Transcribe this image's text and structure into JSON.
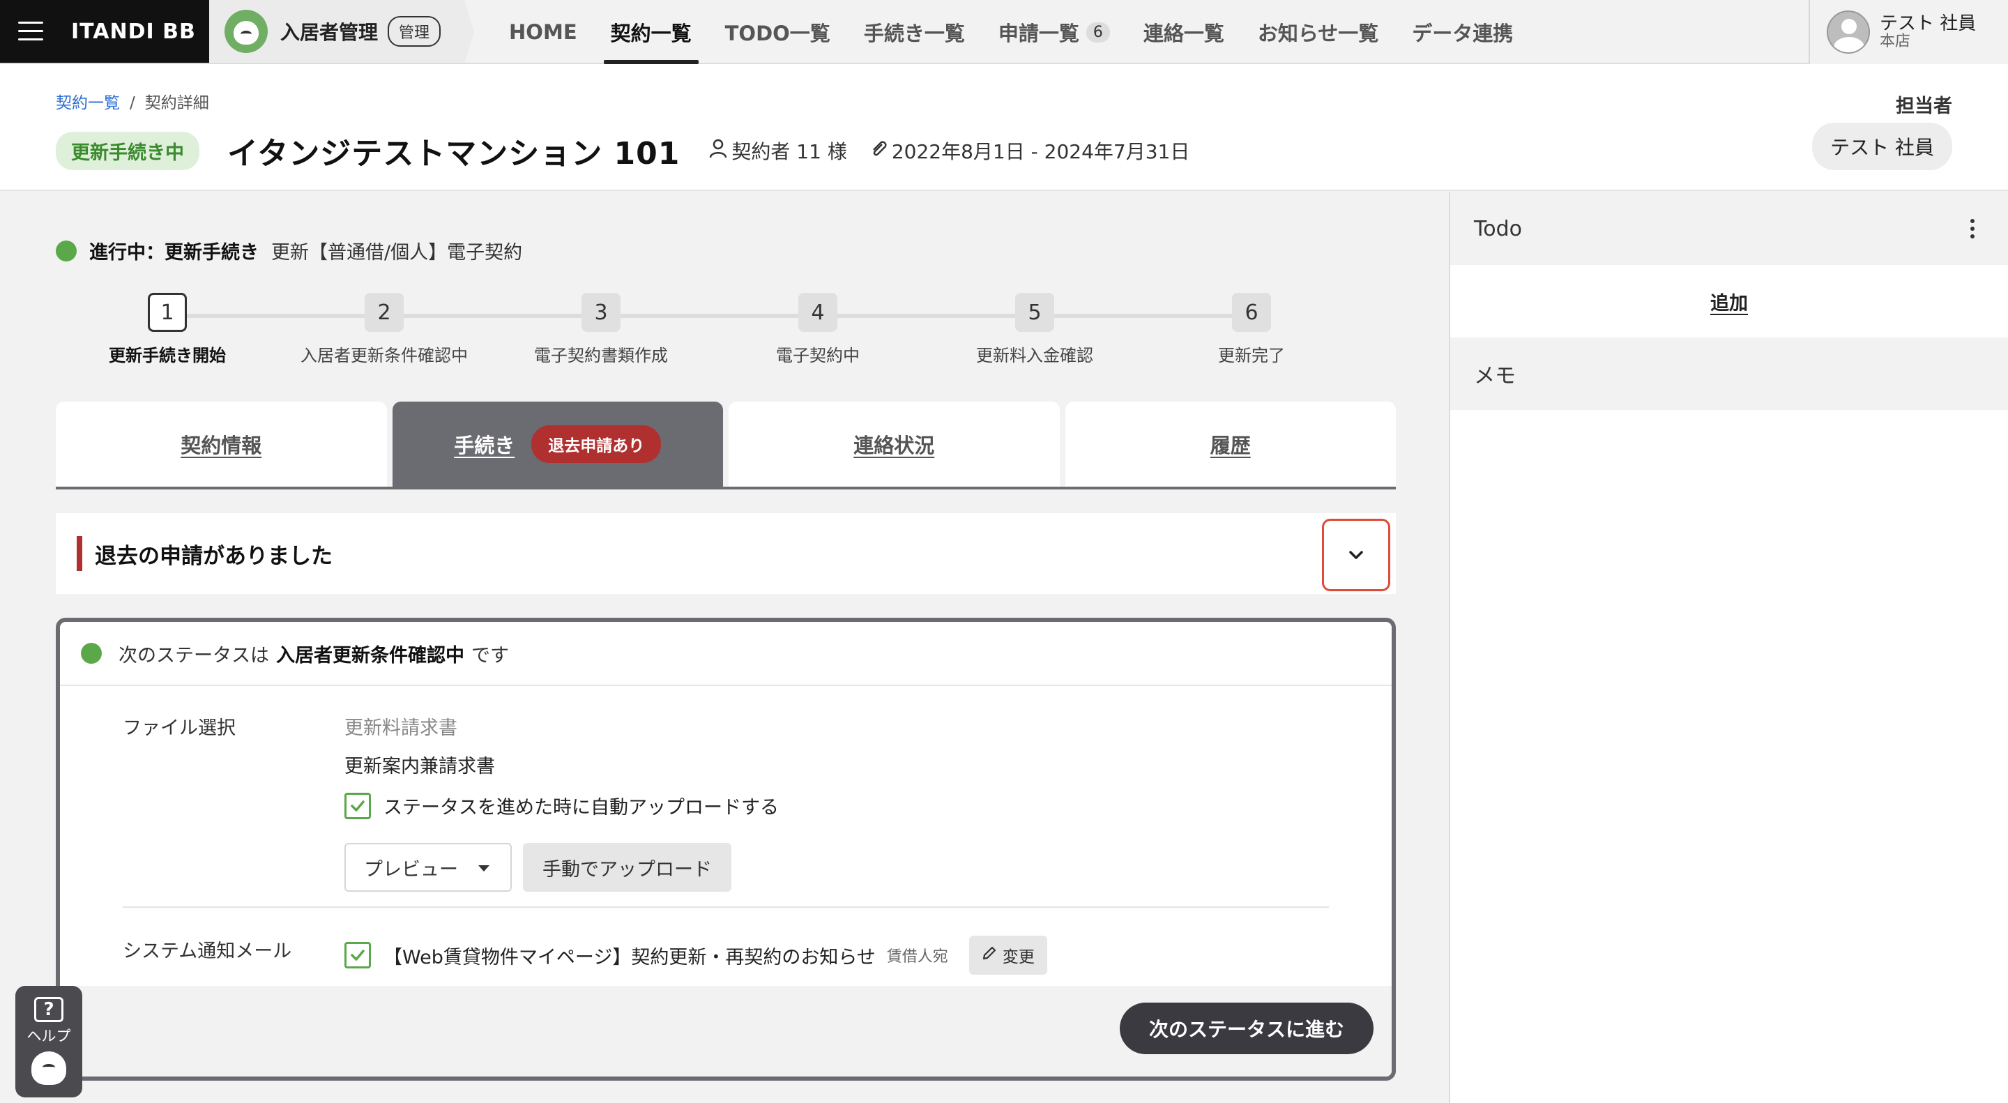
{
  "nav": {
    "brand": "ITANDI BB",
    "product": "入居者管理",
    "admin_badge": "管理",
    "links": [
      {
        "label": "HOME"
      },
      {
        "label": "契約一覧"
      },
      {
        "label": "TODO一覧"
      },
      {
        "label": "手続き一覧"
      },
      {
        "label": "申請一覧",
        "count": "6"
      },
      {
        "label": "連絡一覧"
      },
      {
        "label": "お知らせ一覧"
      },
      {
        "label": "データ連携"
      }
    ],
    "user": {
      "name": "テスト 社員",
      "branch": "本店"
    }
  },
  "breadcrumb": {
    "parent": "契約一覧",
    "separator": "/",
    "current": "契約詳細"
  },
  "header": {
    "status": "更新手続き中",
    "title": "イタンジテストマンション 101",
    "contractors": "契約者 11 様",
    "period": "2022年8月1日 - 2024年7月31日",
    "assignee_label": "担当者",
    "assignee": "テスト 社員"
  },
  "progress": {
    "head": "進行中：更新手続き",
    "sub": "更新【普通借/個人】電子契約",
    "steps": [
      {
        "num": "1",
        "label": "更新手続き開始"
      },
      {
        "num": "2",
        "label": "入居者更新条件確認中"
      },
      {
        "num": "3",
        "label": "電子契約書類作成"
      },
      {
        "num": "4",
        "label": "電子契約中"
      },
      {
        "num": "5",
        "label": "更新料入金確認"
      },
      {
        "num": "6",
        "label": "更新完了"
      }
    ]
  },
  "tabs": {
    "contract": "契約情報",
    "procedure": "手続き",
    "procedure_badge": "退去申請あり",
    "contact": "連絡状況",
    "history": "履歴"
  },
  "notice": {
    "text": "退去の申請がありました"
  },
  "status_card": {
    "prefix": "次のステータスは",
    "next_status": "入居者更新条件確認中",
    "suffix": "です",
    "file_label": "ファイル選択",
    "file_options": [
      "更新料請求書",
      "更新案内兼請求書"
    ],
    "auto_upload": "ステータスを進めた時に自動アップロードする",
    "preview": "プレビュー",
    "manual_upload": "手動でアップロード",
    "mail_label": "システム通知メール",
    "mail_subject": "【Web賃貸物件マイページ】契約更新・再契約のお知らせ",
    "mail_recipient": "賃借人宛",
    "change": "変更",
    "next_button": "次のステータスに進む"
  },
  "help": {
    "label": "ヘルプ",
    "glyph": "?"
  },
  "side": {
    "todo_title": "Todo",
    "add": "追加",
    "memo_title": "メモ"
  },
  "colors": {
    "accent_green": "#5ba84a",
    "alert_red": "#b03030",
    "tab_active": "#6b6b72"
  }
}
